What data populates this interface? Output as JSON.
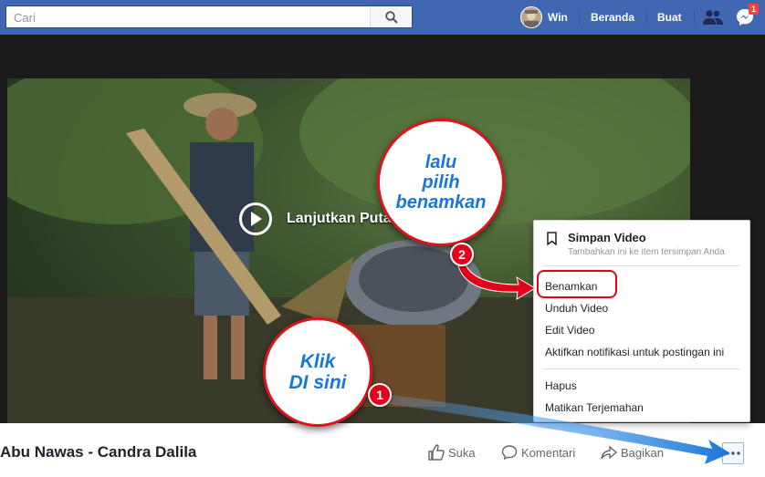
{
  "header": {
    "search_placeholder": "Cari",
    "user_name": "Win",
    "nav_home": "Beranda",
    "nav_create": "Buat",
    "messenger_badge": "1"
  },
  "video": {
    "resume_label": "Lanjutkan Putar Video",
    "title": "Abu Nawas - Candra Dalila"
  },
  "actions": {
    "like": "Suka",
    "comment": "Komentari",
    "share": "Bagikan"
  },
  "menu": {
    "save_title": "Simpan Video",
    "save_subtitle": "Tambahkan ini ke item tersimpan Anda",
    "items": [
      "Benamkan",
      "Unduh Video",
      "Edit Video",
      "Aktifkan notifikasi untuk postingan ini"
    ],
    "items2": [
      "Hapus",
      "Matikan Terjemahan"
    ]
  },
  "annotations": {
    "bubble1_line1": "Klik",
    "bubble1_line2": "DI sini",
    "bubble1_num": "1",
    "bubble2_line1": "lalu",
    "bubble2_line2": "pilih",
    "bubble2_line3": "benamkan",
    "bubble2_num": "2"
  },
  "colors": {
    "facebook_blue": "#4267b2",
    "annotation_red": "#e3001b",
    "annotation_blue": "#1877d8"
  }
}
